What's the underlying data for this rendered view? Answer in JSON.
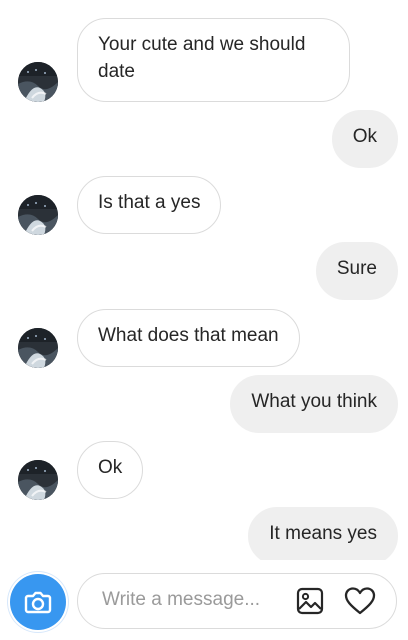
{
  "messages": [
    {
      "side": "in",
      "text": "Your cute and we should date"
    },
    {
      "side": "out",
      "text": "Ok"
    },
    {
      "side": "in",
      "text": "Is that a yes"
    },
    {
      "side": "out",
      "text": "Sure"
    },
    {
      "side": "in",
      "text": "What does that mean"
    },
    {
      "side": "out",
      "text": "What you think"
    },
    {
      "side": "in",
      "text": "Ok"
    },
    {
      "side": "out",
      "text": "It means yes"
    }
  ],
  "composer": {
    "placeholder": "Write a message...",
    "camera_icon": "camera-icon",
    "gallery_icon": "image-gallery-icon",
    "like_icon": "heart-icon",
    "accent_color": "#3897f0"
  },
  "colors": {
    "incoming_border": "#dbdbdb",
    "outgoing_bg": "#efefef",
    "text": "#262626"
  }
}
